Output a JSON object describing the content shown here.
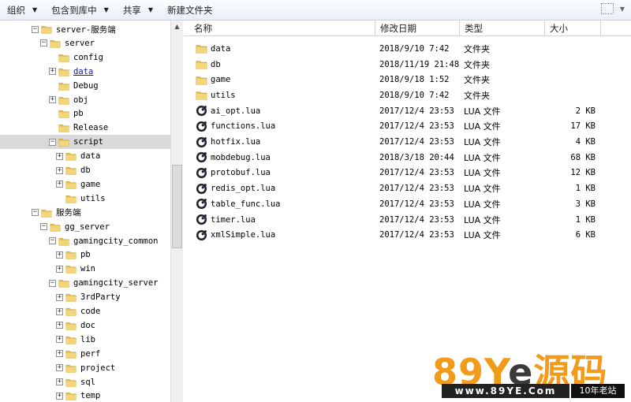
{
  "toolbar": {
    "organize": "组织",
    "include_in_library": "包含到库中",
    "share": "共享",
    "new_folder": "新建文件夹"
  },
  "tree": {
    "items": [
      {
        "label": "server-服务端",
        "depth": 0,
        "expander": "−",
        "selected": false,
        "link": false
      },
      {
        "label": "server",
        "depth": 1,
        "expander": "−",
        "selected": false,
        "link": false
      },
      {
        "label": "config",
        "depth": 2,
        "expander": "",
        "selected": false,
        "link": false
      },
      {
        "label": "data",
        "depth": 2,
        "expander": "+",
        "selected": false,
        "link": true
      },
      {
        "label": "Debug",
        "depth": 2,
        "expander": "",
        "selected": false,
        "link": false
      },
      {
        "label": "obj",
        "depth": 2,
        "expander": "+",
        "selected": false,
        "link": false
      },
      {
        "label": "pb",
        "depth": 2,
        "expander": "",
        "selected": false,
        "link": false
      },
      {
        "label": "Release",
        "depth": 2,
        "expander": "",
        "selected": false,
        "link": false
      },
      {
        "label": "script",
        "depth": 2,
        "expander": "−",
        "selected": true,
        "link": false
      },
      {
        "label": "data",
        "depth": 3,
        "expander": "+",
        "selected": false,
        "link": false
      },
      {
        "label": "db",
        "depth": 3,
        "expander": "+",
        "selected": false,
        "link": false
      },
      {
        "label": "game",
        "depth": 3,
        "expander": "+",
        "selected": false,
        "link": false
      },
      {
        "label": "utils",
        "depth": 3,
        "expander": "",
        "selected": false,
        "link": false
      },
      {
        "label": "服务端",
        "depth": 0,
        "expander": "−",
        "selected": false,
        "link": false
      },
      {
        "label": "gg_server",
        "depth": 1,
        "expander": "−",
        "selected": false,
        "link": false
      },
      {
        "label": "gamingcity_common",
        "depth": 2,
        "expander": "−",
        "selected": false,
        "link": false
      },
      {
        "label": "pb",
        "depth": 3,
        "expander": "+",
        "selected": false,
        "link": false
      },
      {
        "label": "win",
        "depth": 3,
        "expander": "+",
        "selected": false,
        "link": false
      },
      {
        "label": "gamingcity_server",
        "depth": 2,
        "expander": "−",
        "selected": false,
        "link": false
      },
      {
        "label": "3rdParty",
        "depth": 3,
        "expander": "+",
        "selected": false,
        "link": false
      },
      {
        "label": "code",
        "depth": 3,
        "expander": "+",
        "selected": false,
        "link": false
      },
      {
        "label": "doc",
        "depth": 3,
        "expander": "+",
        "selected": false,
        "link": false
      },
      {
        "label": "lib",
        "depth": 3,
        "expander": "+",
        "selected": false,
        "link": false
      },
      {
        "label": "perf",
        "depth": 3,
        "expander": "+",
        "selected": false,
        "link": false
      },
      {
        "label": "project",
        "depth": 3,
        "expander": "+",
        "selected": false,
        "link": false
      },
      {
        "label": "sql",
        "depth": 3,
        "expander": "+",
        "selected": false,
        "link": false
      },
      {
        "label": "temp",
        "depth": 3,
        "expander": "+",
        "selected": false,
        "link": false
      }
    ]
  },
  "columns": {
    "name": "名称",
    "modified": "修改日期",
    "type": "类型",
    "size": "大小"
  },
  "files": [
    {
      "name": "data",
      "modified": "2018/9/10 7:42",
      "type": "文件夹",
      "size": "",
      "icon": "folder-icon"
    },
    {
      "name": "db",
      "modified": "2018/11/19 21:48",
      "type": "文件夹",
      "size": "",
      "icon": "folder-icon"
    },
    {
      "name": "game",
      "modified": "2018/9/18 1:52",
      "type": "文件夹",
      "size": "",
      "icon": "folder-icon"
    },
    {
      "name": "utils",
      "modified": "2018/9/10 7:42",
      "type": "文件夹",
      "size": "",
      "icon": "folder-icon"
    },
    {
      "name": "ai_opt.lua",
      "modified": "2017/12/4 23:53",
      "type": "LUA 文件",
      "size": "2 KB",
      "icon": "lua-file-icon"
    },
    {
      "name": "functions.lua",
      "modified": "2017/12/4 23:53",
      "type": "LUA 文件",
      "size": "17 KB",
      "icon": "lua-file-icon"
    },
    {
      "name": "hotfix.lua",
      "modified": "2017/12/4 23:53",
      "type": "LUA 文件",
      "size": "4 KB",
      "icon": "lua-file-icon"
    },
    {
      "name": "mobdebug.lua",
      "modified": "2018/3/18 20:44",
      "type": "LUA 文件",
      "size": "68 KB",
      "icon": "lua-file-icon"
    },
    {
      "name": "protobuf.lua",
      "modified": "2017/12/4 23:53",
      "type": "LUA 文件",
      "size": "12 KB",
      "icon": "lua-file-icon"
    },
    {
      "name": "redis_opt.lua",
      "modified": "2017/12/4 23:53",
      "type": "LUA 文件",
      "size": "1 KB",
      "icon": "lua-file-icon"
    },
    {
      "name": "table_func.lua",
      "modified": "2017/12/4 23:53",
      "type": "LUA 文件",
      "size": "3 KB",
      "icon": "lua-file-icon"
    },
    {
      "name": "timer.lua",
      "modified": "2017/12/4 23:53",
      "type": "LUA 文件",
      "size": "1 KB",
      "icon": "lua-file-icon"
    },
    {
      "name": "xmlSimple.lua",
      "modified": "2017/12/4 23:53",
      "type": "LUA 文件",
      "size": "6 KB",
      "icon": "lua-file-icon"
    }
  ],
  "watermark": {
    "logo_prefix": "89Y",
    "logo_mid": "e",
    "logo_suffix": "源码",
    "url": "www.89YE.Com",
    "tag": "10年老站"
  },
  "colors": {
    "folder": "#e8c15a",
    "selection": "#d9d9d9",
    "link": "#1a1aa6",
    "watermark_orange": "#f29a1a",
    "watermark_dark": "#3a3a3a"
  }
}
